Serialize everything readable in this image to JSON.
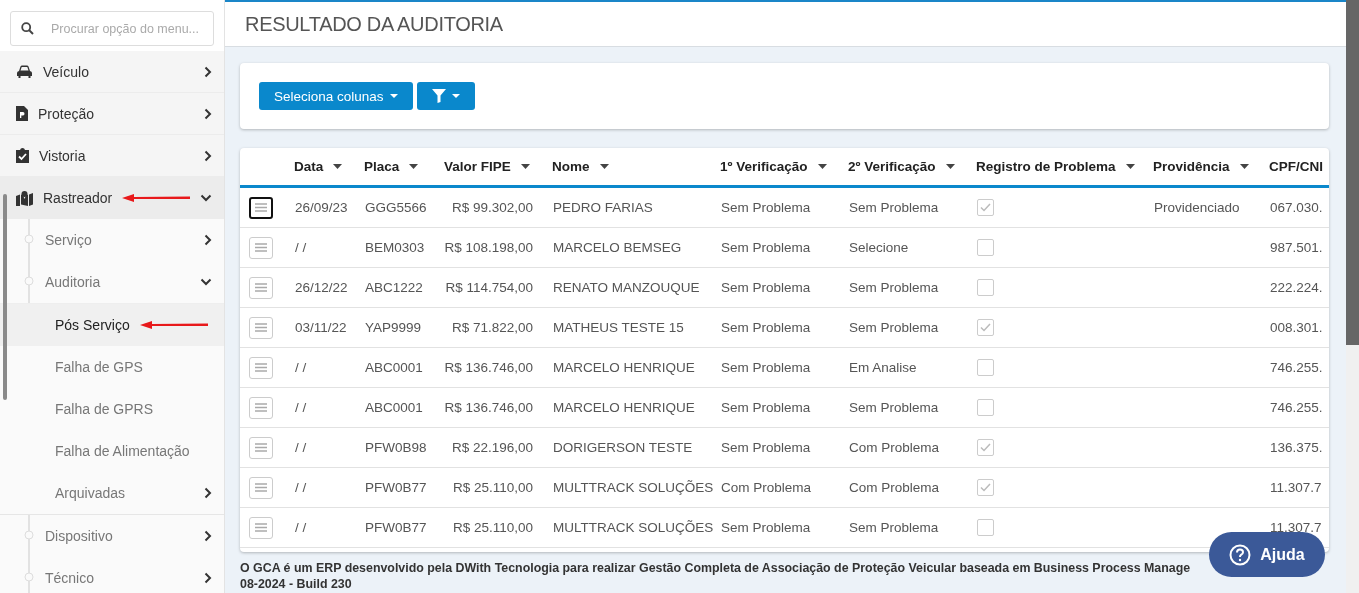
{
  "sidebar": {
    "search": {
      "placeholder": "Procurar opção do menu..."
    },
    "items": [
      {
        "label": "Veículo",
        "expanded": false,
        "marked": false
      },
      {
        "label": "Proteção",
        "expanded": false,
        "marked": false
      },
      {
        "label": "Vistoria",
        "expanded": false,
        "marked": false
      },
      {
        "label": "Rastreador",
        "expanded": true,
        "marked": true,
        "children": [
          {
            "label": "Serviço",
            "kind": "group",
            "expanded": false
          },
          {
            "label": "Auditoria",
            "kind": "group",
            "expanded": true,
            "children": [
              {
                "label": "Pós Serviço",
                "kind": "leaf",
                "selected": true,
                "marked": true
              },
              {
                "label": "Falha de GPS",
                "kind": "leaf",
                "selected": false,
                "marked": false
              },
              {
                "label": "Falha de GPRS",
                "kind": "leaf",
                "selected": false,
                "marked": false
              },
              {
                "label": "Falha de Alimentação",
                "kind": "leaf",
                "selected": false,
                "marked": false
              },
              {
                "label": "Arquivadas",
                "kind": "group",
                "expanded": false
              }
            ]
          },
          {
            "label": "Dispositivo",
            "kind": "group",
            "expanded": false
          },
          {
            "label": "Técnico",
            "kind": "group",
            "expanded": false
          }
        ]
      }
    ]
  },
  "page": {
    "title": "RESULTADO DA AUDITORIA"
  },
  "toolbar": {
    "columns_button": "Seleciona colunas"
  },
  "table": {
    "columns": [
      "Data",
      "Placa",
      "Valor FIPE",
      "Nome",
      "1º Verificação",
      "2º Verificação",
      "Registro de Problema",
      "Providência",
      "CPF/CNI"
    ],
    "rows": [
      {
        "focused": true,
        "data": "26/09/23",
        "placa": "GGG5566",
        "valor": "R$ 99.302,00",
        "nome": "PEDRO FARIAS",
        "v1": "Sem Problema",
        "v2": "Sem Problema",
        "problema": true,
        "providencia": "Providenciado",
        "cpf": "067.030."
      },
      {
        "focused": false,
        "data": "/ /",
        "placa": "BEM0303",
        "valor": "R$ 108.198,00",
        "nome": "MARCELO BEMSEG",
        "v1": "Sem Problema",
        "v2": "Selecione",
        "problema": false,
        "cpf": "987.501."
      },
      {
        "focused": false,
        "data": "26/12/22",
        "placa": "ABC1222",
        "valor": "R$ 114.754,00",
        "nome": "RENATO MANZOUQUE",
        "v1": "Sem Problema",
        "v2": "Sem Problema",
        "problema": false,
        "cpf": "222.224."
      },
      {
        "focused": false,
        "data": "03/11/22",
        "placa": "YAP9999",
        "valor": "R$ 71.822,00",
        "nome": "MATHEUS TESTE 15",
        "v1": "Sem Problema",
        "v2": "Sem Problema",
        "problema": true,
        "cpf": "008.301."
      },
      {
        "focused": false,
        "data": "/ /",
        "placa": "ABC0001",
        "valor": "R$ 136.746,00",
        "nome": "MARCELO HENRIQUE",
        "v1": "Sem Problema",
        "v2": "Em Analise",
        "problema": false,
        "cpf": "746.255."
      },
      {
        "focused": false,
        "data": "/ /",
        "placa": "ABC0001",
        "valor": "R$ 136.746,00",
        "nome": "MARCELO HENRIQUE",
        "v1": "Sem Problema",
        "v2": "Sem Problema",
        "problema": false,
        "cpf": "746.255."
      },
      {
        "focused": false,
        "data": "/ /",
        "placa": "PFW0B98",
        "valor": "R$ 22.196,00",
        "nome": "DORIGERSON TESTE",
        "v1": "Sem Problema",
        "v2": "Com Problema",
        "problema": true,
        "cpf": "136.375."
      },
      {
        "focused": false,
        "data": "/ /",
        "placa": "PFW0B77",
        "valor": "R$ 25.110,00",
        "nome": "MULTTRACK SOLUÇÕES",
        "v1": "Com Problema",
        "v2": "Com Problema",
        "problema": true,
        "cpf": "11.307.7"
      },
      {
        "focused": false,
        "data": "/ /",
        "placa": "PFW0B77",
        "valor": "R$ 25.110,00",
        "nome": "MULTTRACK SOLUÇÕES",
        "v1": "Sem Problema",
        "v2": "Sem Problema",
        "problema": false,
        "cpf": "11.307.7"
      }
    ]
  },
  "footer": {
    "line_1": "O GCA é um ERP desenvolvido pela DWith Tecnologia para realizar Gestão Completa de Associação de Proteção Veicular baseada em Business Process Manage",
    "line_2": "08-2024 - Build 230"
  },
  "help_button": "Ajuda"
}
